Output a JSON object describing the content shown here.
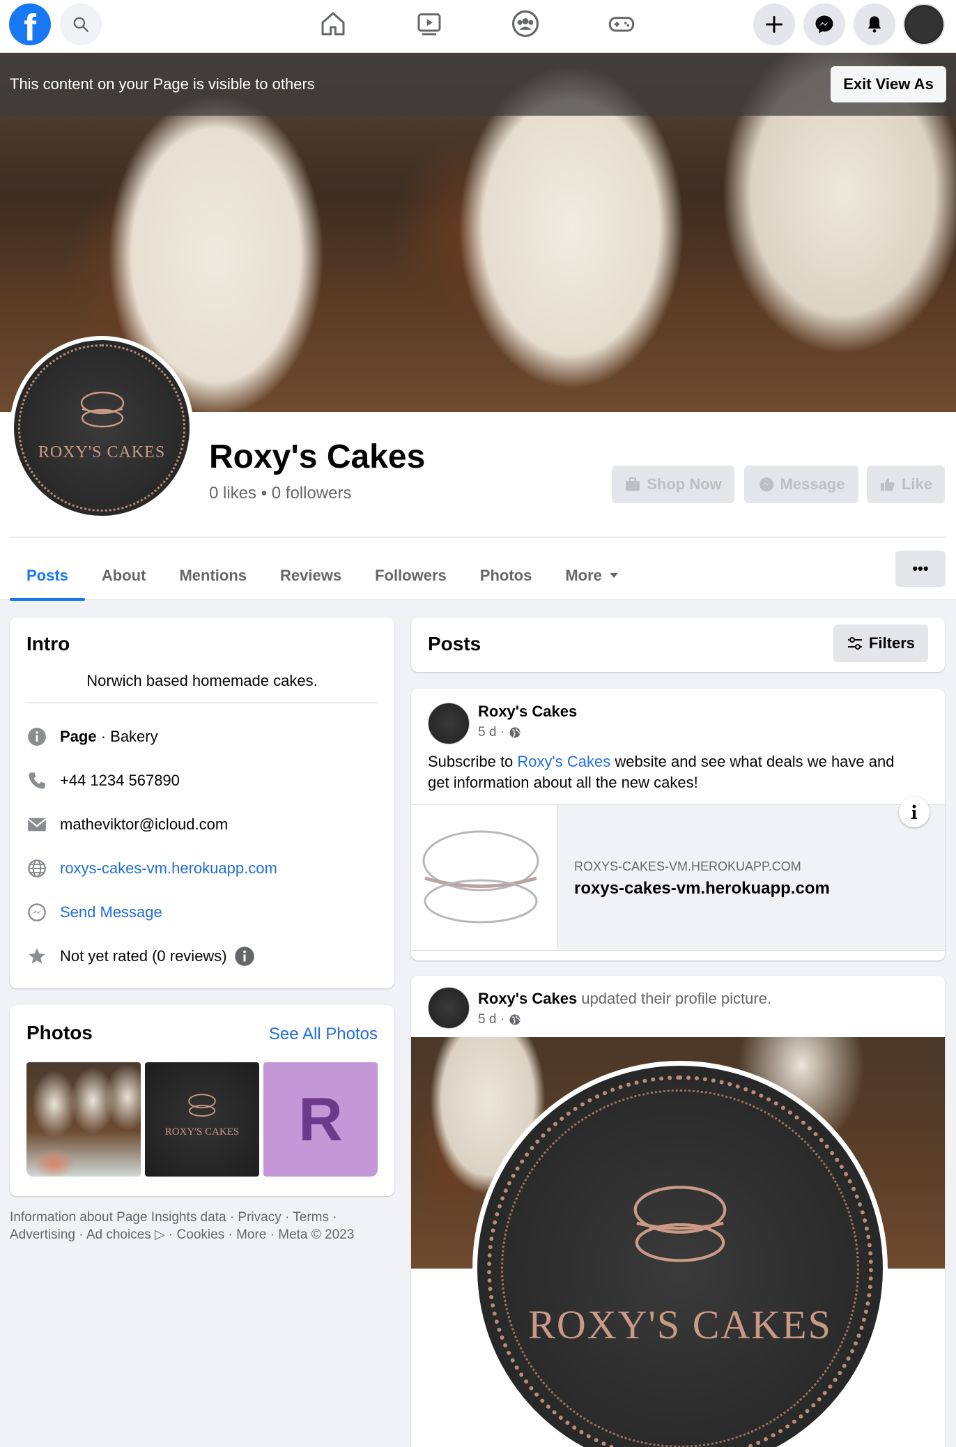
{
  "topbar": {
    "logo": "f",
    "icons": [
      "search-icon",
      "home-icon",
      "watch-icon",
      "groups-icon",
      "gaming-icon",
      "create-icon",
      "messenger-icon",
      "notifications-icon",
      "account-icon"
    ]
  },
  "banner": {
    "text": "This content on your Page is visible to others",
    "exit_label": "Exit View As"
  },
  "page": {
    "name": "Roxy's Cakes",
    "stats": "0 likes • 0 followers",
    "logo_text": "ROXY'S CAKES",
    "buttons": {
      "shop": "Shop Now",
      "message": "Message",
      "like": "Like"
    }
  },
  "tabs": [
    "Posts",
    "About",
    "Mentions",
    "Reviews",
    "Followers",
    "Photos",
    "More"
  ],
  "tabs_more_ellipsis": "•••",
  "intro": {
    "title": "Intro",
    "bio": "Norwich based homemade cakes.",
    "category_bold": "Page",
    "category_rest": " · Bakery",
    "phone": "+44 1234 567890",
    "email": "matheviktor@icloud.com",
    "website": "roxys-cakes-vm.herokuapp.com",
    "send_message": "Send Message",
    "rating": "Not yet rated (0 reviews)"
  },
  "photos": {
    "title": "Photos",
    "see_all": "See All Photos",
    "letter_thumb": "R"
  },
  "footer": {
    "line1": "Information about Page Insights data · Privacy · Terms ·",
    "line2": "Advertising · Ad choices ▷ · Cookies · More · Meta © 2023"
  },
  "posts_header": {
    "title": "Posts",
    "filters": "Filters"
  },
  "post1": {
    "author": "Roxy's Cakes",
    "time": "5 d ·",
    "text_before": "Subscribe to ",
    "text_link": "Roxy's Cakes",
    "text_after": " website and see what deals we have and",
    "text_line2": "get information about all the new cakes!",
    "link_domain": "ROXYS-CAKES-VM.HEROKUAPP.COM",
    "link_title": "roxys-cakes-vm.herokuapp.com"
  },
  "post2": {
    "author": "Roxy's Cakes",
    "action": " updated their profile picture.",
    "time": "5 d ·",
    "logo_text": "ROXY'S CAKES"
  },
  "colors": {
    "accent": "#1877f2",
    "link": "#216fdb",
    "background": "#f0f2f5",
    "photo_letter_bg": "#c497d6",
    "photo_letter": "#6b3a8a"
  }
}
